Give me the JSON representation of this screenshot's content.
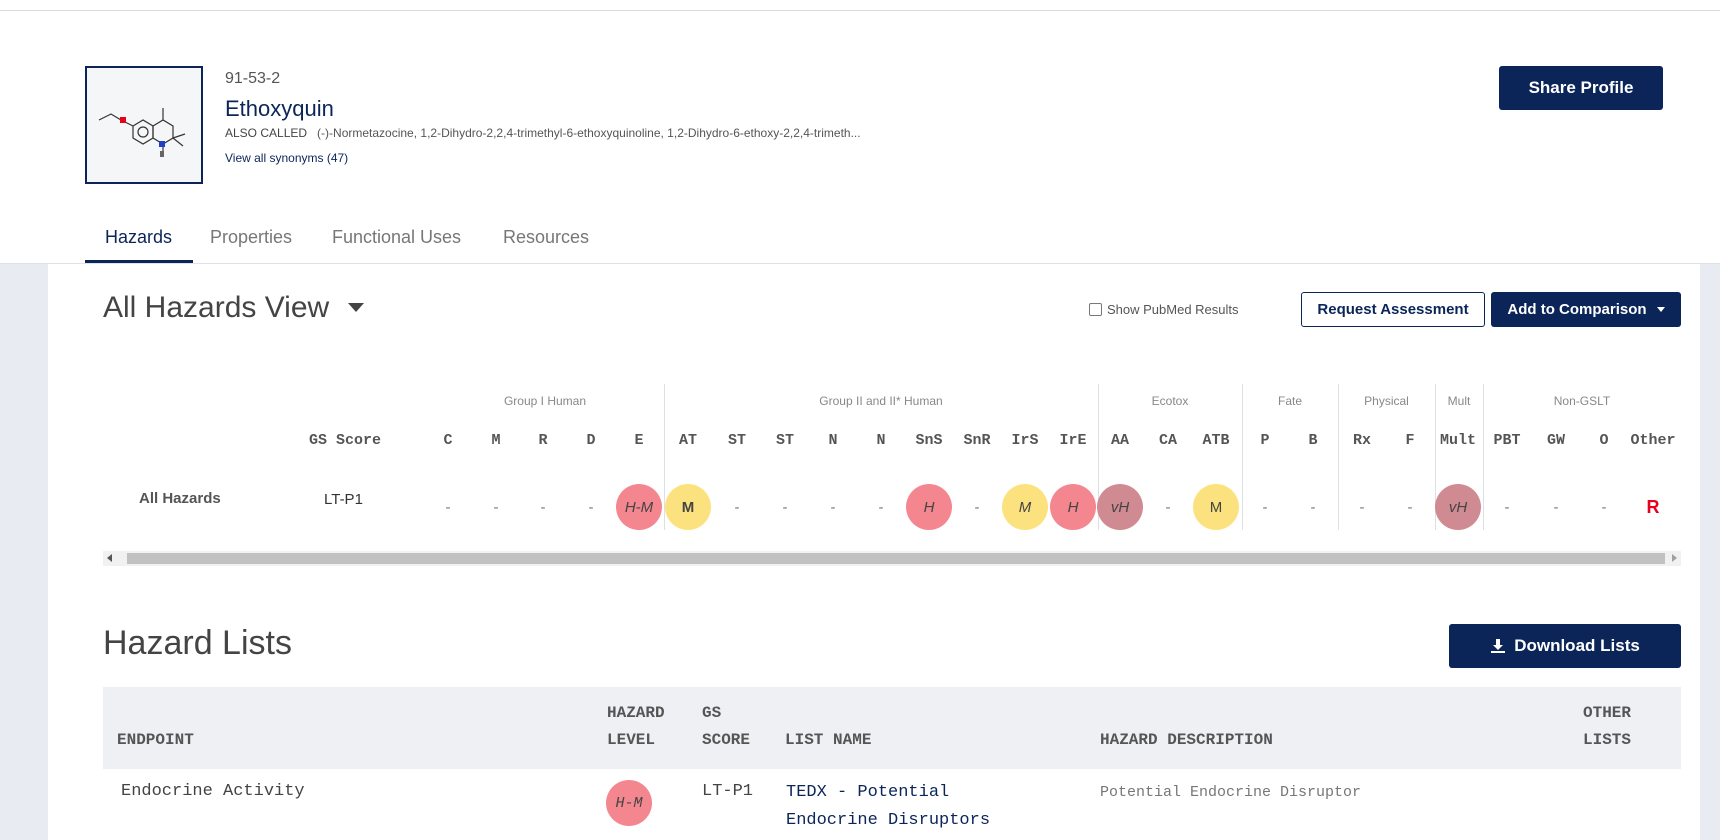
{
  "profile": {
    "cas": "91-53-2",
    "name": "Ethoxyquin",
    "also_called_label": "ALSO CALLED",
    "also_called": "(-)-Normetazocine, 1,2-Dihydro-2,2,4-trimethyl-6-ethoxyquinoline, 1,2-Dihydro-6-ethoxy-2,2,4-trimeth...",
    "synonyms_link": "View all synonyms (47)",
    "share_label": "Share Profile"
  },
  "tabs": [
    "Hazards",
    "Properties",
    "Functional Uses",
    "Resources"
  ],
  "active_tab": "Hazards",
  "hazards_view": {
    "title": "All Hazards View",
    "pubmed_label": "Show PubMed Results",
    "pubmed_checked": false,
    "request_label": "Request Assessment",
    "compare_label": "Add to Comparison",
    "groups": [
      "Group I Human",
      "Group II and II* Human",
      "Ecotox",
      "Fate",
      "Physical",
      "Mult",
      "Non-GSLT"
    ],
    "gs_header": "GS Score",
    "columns": [
      "C",
      "M",
      "R",
      "D",
      "E",
      "AT",
      "ST",
      "ST",
      "N",
      "N",
      "SnS",
      "SnR",
      "IrS",
      "IrE",
      "AA",
      "CA",
      "ATB",
      "P",
      "B",
      "Rx",
      "F",
      "Mult",
      "PBT",
      "GW",
      "O",
      "Other"
    ],
    "row_label": "All Hazards",
    "gs_score": "LT-P1",
    "values": [
      "-",
      "-",
      "-",
      "-",
      "H-M",
      "M",
      "-",
      "-",
      "-",
      "-",
      "H",
      "-",
      "M",
      "H",
      "vH",
      "-",
      "M",
      "-",
      "-",
      "-",
      "-",
      "vH",
      "-",
      "-",
      "-",
      "R"
    ],
    "colors": {
      "pink": "#f3868f",
      "yellow": "#fbe27e",
      "mauve": "#cf8b91",
      "red": "#e8001c",
      "navy": "#0b2559"
    }
  },
  "hazard_lists": {
    "title": "Hazard Lists",
    "download_label": "Download Lists",
    "headers": {
      "endpoint": "ENDPOINT",
      "hazard_level_1": "HAZARD",
      "hazard_level_2": "LEVEL",
      "gs_score_1": "GS",
      "gs_score_2": "SCORE",
      "list_name": "LIST NAME",
      "hazard_description": "HAZARD DESCRIPTION",
      "other_lists_1": "OTHER",
      "other_lists_2": "LISTS"
    },
    "rows": [
      {
        "endpoint": "Endocrine Activity",
        "hazard_level": "H-M",
        "gs_score": "LT-P1",
        "list_name_1": "TEDX - Potential",
        "list_name_2": "Endocrine Disruptors",
        "hazard_description": "Potential Endocrine Disruptor"
      }
    ]
  }
}
